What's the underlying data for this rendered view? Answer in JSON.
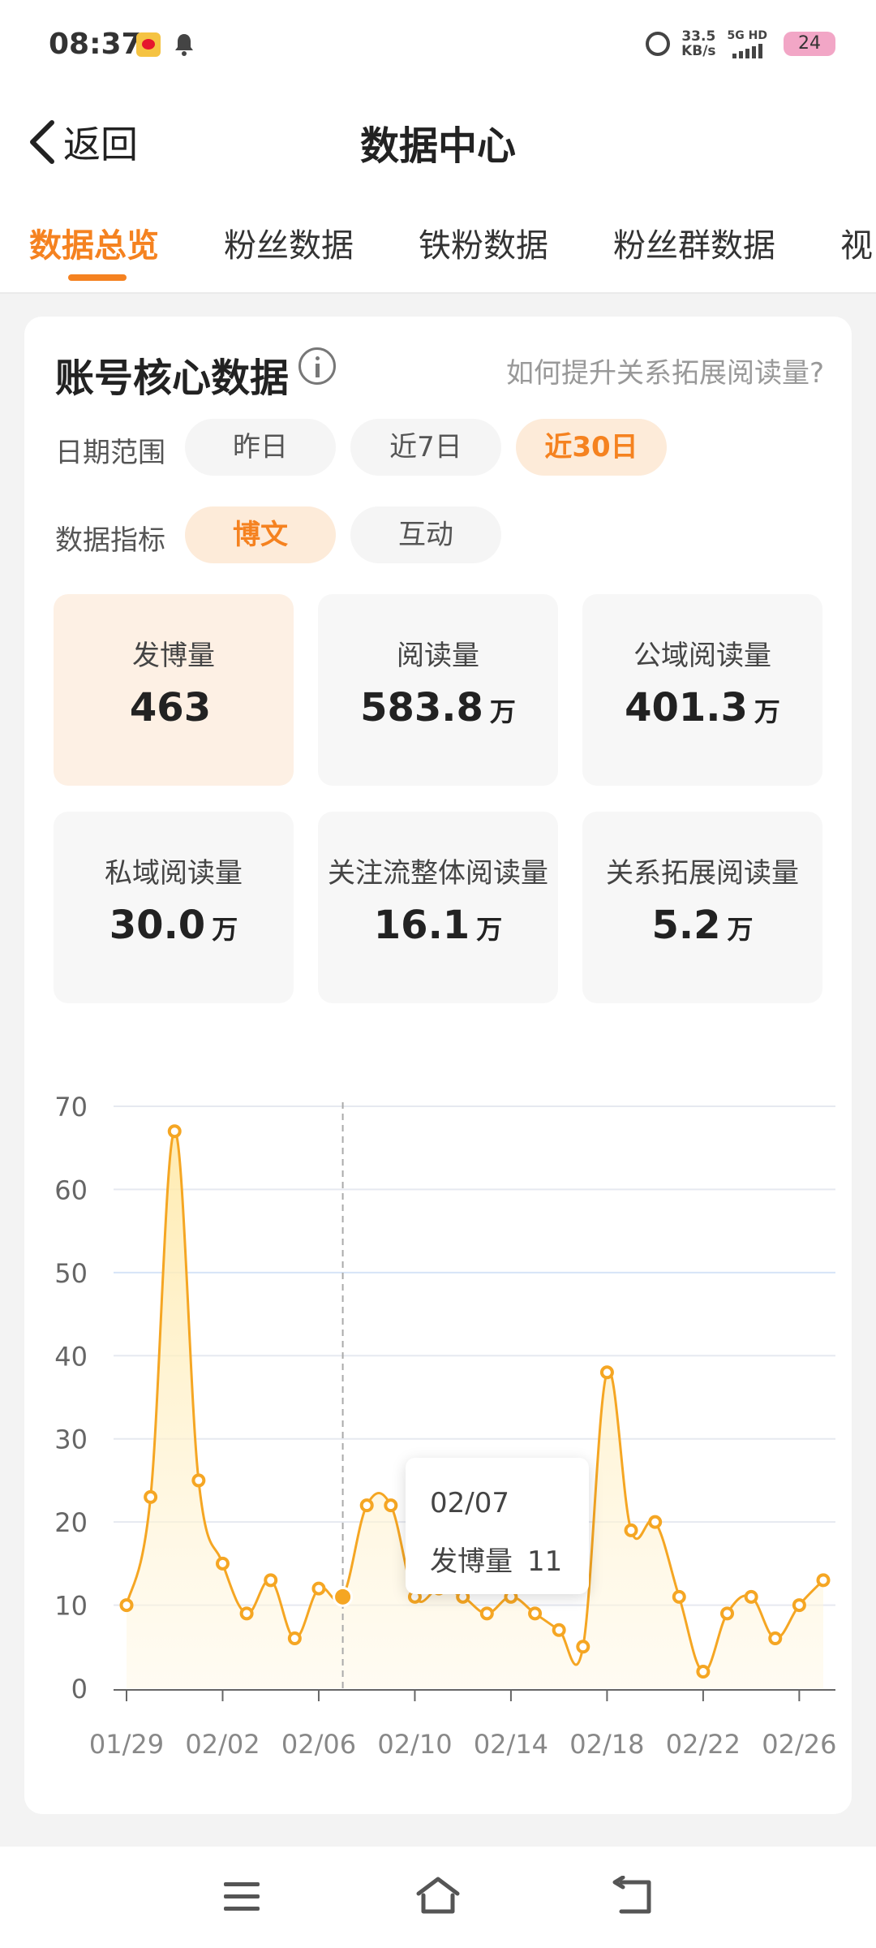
{
  "status": {
    "time": "08:37",
    "speed_value": "33.5",
    "speed_unit": "KB/s",
    "network": "5G HD",
    "battery": "24"
  },
  "nav": {
    "back_label": "返回",
    "title": "数据中心"
  },
  "tabs": [
    "数据总览",
    "粉丝数据",
    "铁粉数据",
    "粉丝群数据",
    "视"
  ],
  "card": {
    "title": "账号核心数据",
    "help_link": "如何提升关系拓展阅读量?",
    "date_range_label": "日期范围",
    "date_options": [
      "昨日",
      "近7日",
      "近30日"
    ],
    "metric_label": "数据指标",
    "metric_options": [
      "博文",
      "互动"
    ],
    "metrics": [
      {
        "label": "发博量",
        "value": "463",
        "unit": ""
      },
      {
        "label": "阅读量",
        "value": "583.8",
        "unit": "万"
      },
      {
        "label": "公域阅读量",
        "value": "401.3",
        "unit": "万"
      },
      {
        "label": "私域阅读量",
        "value": "30.0",
        "unit": "万"
      },
      {
        "label": "关注流整体阅读量",
        "value": "16.1",
        "unit": "万"
      },
      {
        "label": "关系拓展阅读量",
        "value": "5.2",
        "unit": "万"
      }
    ]
  },
  "tooltip": {
    "date": "02/07",
    "label": "发博量",
    "value": "11"
  },
  "colors": {
    "accent": "#f58220",
    "line": "#f5a623",
    "fill": "#fff3d1"
  },
  "chart_data": {
    "type": "area",
    "x": [
      "01/29",
      "01/30",
      "01/31",
      "02/01",
      "02/02",
      "02/03",
      "02/04",
      "02/05",
      "02/06",
      "02/07",
      "02/08",
      "02/09",
      "02/10",
      "02/11",
      "02/12",
      "02/13",
      "02/14",
      "02/15",
      "02/16",
      "02/17",
      "02/18",
      "02/19",
      "02/20",
      "02/21",
      "02/22",
      "02/23",
      "02/24",
      "02/25",
      "02/26",
      "02/27"
    ],
    "series": [
      {
        "values": [
          10,
          23,
          67,
          25,
          15,
          9,
          13,
          6,
          12,
          11,
          22,
          22,
          11,
          12,
          11,
          9,
          11,
          9,
          7,
          5,
          38,
          19,
          20,
          11,
          2,
          9,
          11,
          6,
          10,
          13
        ]
      }
    ],
    "xtick_labels": [
      "01/29",
      "02/02",
      "02/06",
      "02/10",
      "02/14",
      "02/18",
      "02/22",
      "02/26"
    ],
    "yticks": [
      0,
      10,
      20,
      30,
      40,
      50,
      60,
      70
    ],
    "ylim": [
      0,
      70
    ],
    "highlight_x": "02/07",
    "grid": true,
    "legend": "none"
  }
}
